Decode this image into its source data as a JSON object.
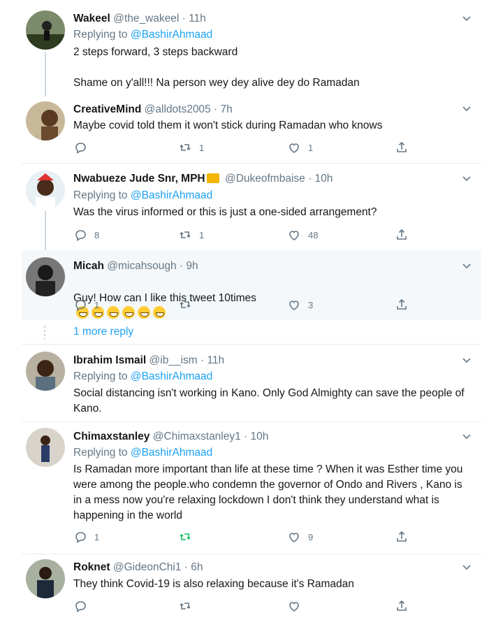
{
  "tweets": [
    {
      "name": "Wakeel",
      "handle": "@the_wakeel · 11h",
      "replying_prefix": "Replying to",
      "replying_to": "@BashirAhmaad",
      "text": "2 steps forward, 3 steps backward\n\nShame on y'all!!! Na person wey dey alive dey do Ramadan"
    },
    {
      "name": "CreativeMind",
      "handle": "@alldots2005 · 7h",
      "text": "Maybe covid told them it won't stick during Ramadan who knows",
      "replies": "",
      "retweets": "1",
      "likes": "1"
    },
    {
      "name": "Nwabueze Jude Snr, MPH",
      "handle": "@Dukeofmbaise · 10h",
      "replying_prefix": "Replying to",
      "replying_to": "@BashirAhmaad",
      "text": "Was the virus informed or this is just a one-sided arrangement?",
      "replies": "8",
      "retweets": "1",
      "likes": "48"
    },
    {
      "name": "Micah",
      "handle": "@micahsough · 9h",
      "text": "Guy!  How can I like this tweet 10times",
      "replies": "1",
      "retweets": "",
      "likes": "3"
    },
    {
      "name": "Ibrahim Ismail",
      "handle": "@ib__ism · 11h",
      "replying_prefix": "Replying to",
      "replying_to": "@BashirAhmaad",
      "text": "Social distancing isn't working in Kano. Only God Almighty can save the people of Kano."
    },
    {
      "name": "Chimaxstanley",
      "handle": "@Chimaxstanley1 · 10h",
      "replying_prefix": "Replying to",
      "replying_to": "@BashirAhmaad",
      "text": "Is Ramadan more important than life at these time ? When it was Esther time you were among the people.who condemn the governor of Ondo and Rivers , Kano is in a mess now you're relaxing lockdown I don't think they understand what is happening in the world",
      "replies": "1",
      "retweets": "",
      "likes": "9"
    },
    {
      "name": "Roknet",
      "handle": "@GideonChi1 · 6h",
      "text": "They think Covid-19 is also relaxing because it's Ramadan",
      "replies": "",
      "retweets": "",
      "likes": ""
    }
  ],
  "more_replies": "1 more reply",
  "colors": {
    "link": "#1da1f2",
    "muted": "#657786",
    "text": "#14171a",
    "highlight": "#f5f8fa",
    "retweet_active": "#17bf63"
  }
}
